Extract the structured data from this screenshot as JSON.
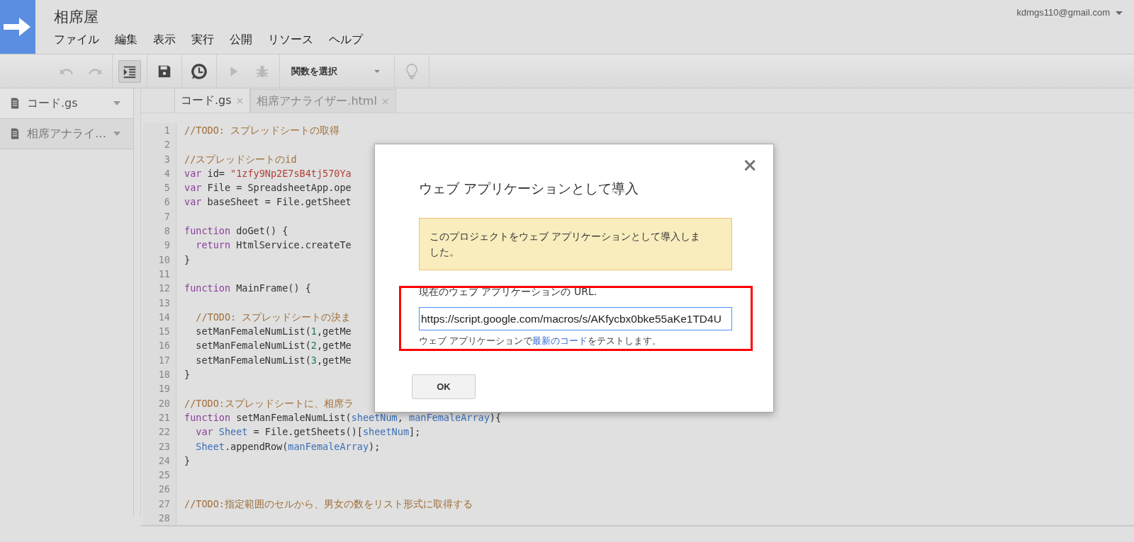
{
  "header": {
    "title": "相席屋",
    "account": "kdmgs110@gmail.com"
  },
  "menu": [
    "ファイル",
    "編集",
    "表示",
    "実行",
    "公開",
    "リソース",
    "ヘルプ"
  ],
  "toolbar": {
    "indent_pressed": true,
    "function_select": "関数を選択"
  },
  "sidebar": {
    "files": [
      {
        "name": "コード.gs",
        "selected": true
      },
      {
        "name": "相席アナライ…",
        "selected": false
      }
    ]
  },
  "tabs": [
    {
      "label": "コード.gs",
      "selected": true,
      "close": "×"
    },
    {
      "label": "相席アナライザー.html",
      "selected": false,
      "close": "×"
    }
  ],
  "code": {
    "lines": [
      {
        "number": "1",
        "tokens": [
          {
            "kind": "comment",
            "text": "//TODO: スプレッドシートの取得"
          }
        ]
      },
      {
        "number": "2"
      },
      {
        "number": "3",
        "tokens": [
          {
            "kind": "comment",
            "text": "//スプレッドシートのid"
          }
        ]
      },
      {
        "number": "4",
        "tokens": [
          {
            "kind": "keyword",
            "text": "var"
          },
          {
            "kind": "plain",
            "text": " id= "
          },
          {
            "kind": "string",
            "text": "\"1zfy9Np2E7sB4tj570Ya"
          }
        ]
      },
      {
        "number": "5",
        "tokens": [
          {
            "kind": "keyword",
            "text": "var"
          },
          {
            "kind": "plain",
            "text": " File = SpreadsheetApp.ope"
          }
        ]
      },
      {
        "number": "6",
        "tokens": [
          {
            "kind": "keyword",
            "text": "var"
          },
          {
            "kind": "plain",
            "text": " baseSheet = File.getSheet"
          }
        ]
      },
      {
        "number": "7"
      },
      {
        "number": "8",
        "tokens": [
          {
            "kind": "keyword",
            "text": "function"
          },
          {
            "kind": "plain",
            "text": " doGet() {"
          }
        ]
      },
      {
        "number": "9",
        "indented": true,
        "tokens": [
          {
            "kind": "keyword",
            "text": "return"
          },
          {
            "kind": "plain",
            "text": " HtmlService.createTe"
          }
        ]
      },
      {
        "number": "10",
        "tokens": [
          {
            "kind": "plain",
            "text": "}"
          }
        ]
      },
      {
        "number": "11"
      },
      {
        "number": "12",
        "tokens": [
          {
            "kind": "keyword",
            "text": "function"
          },
          {
            "kind": "plain",
            "text": " MainFrame() {"
          }
        ]
      },
      {
        "number": "13"
      },
      {
        "number": "14",
        "indented": true,
        "tokens": [
          {
            "kind": "comment",
            "text": "//TODO: スプレッドシートの決ま"
          }
        ]
      },
      {
        "number": "15",
        "indented": true,
        "tokens": [
          {
            "kind": "plain",
            "text": "setManFemaleNumList("
          },
          {
            "kind": "number",
            "text": "1"
          },
          {
            "kind": "plain",
            "text": ",getMe"
          }
        ]
      },
      {
        "number": "16",
        "indented": true,
        "tokens": [
          {
            "kind": "plain",
            "text": "setManFemaleNumList("
          },
          {
            "kind": "number",
            "text": "2"
          },
          {
            "kind": "plain",
            "text": ",getMe"
          }
        ]
      },
      {
        "number": "17",
        "indented": true,
        "tokens": [
          {
            "kind": "plain",
            "text": "setManFemaleNumList("
          },
          {
            "kind": "number",
            "text": "3"
          },
          {
            "kind": "plain",
            "text": ",getMe"
          }
        ]
      },
      {
        "number": "18",
        "tokens": [
          {
            "kind": "plain",
            "text": "}"
          }
        ]
      },
      {
        "number": "19"
      },
      {
        "number": "20",
        "tokens": [
          {
            "kind": "comment",
            "text": "//TODO:スプレッドシートに、相席ラ"
          }
        ]
      },
      {
        "number": "21",
        "tokens": [
          {
            "kind": "keyword",
            "text": "function"
          },
          {
            "kind": "plain",
            "text": " setManFemaleNumList("
          },
          {
            "kind": "variable",
            "text": "sheetNum"
          },
          {
            "kind": "plain",
            "text": ", "
          },
          {
            "kind": "variable",
            "text": "manFemaleArray"
          },
          {
            "kind": "plain",
            "text": "){"
          }
        ]
      },
      {
        "number": "22",
        "indented": true,
        "tokens": [
          {
            "kind": "keyword",
            "text": "var"
          },
          {
            "kind": "variable",
            "text": " Sheet"
          },
          {
            "kind": "plain",
            "text": " = File.getSheets()["
          },
          {
            "kind": "variable",
            "text": "sheetNum"
          },
          {
            "kind": "plain",
            "text": "];"
          }
        ]
      },
      {
        "number": "23",
        "indented": true,
        "tokens": [
          {
            "kind": "variable",
            "text": "Sheet"
          },
          {
            "kind": "plain",
            "text": ".appendRow("
          },
          {
            "kind": "variable",
            "text": "manFemaleArray"
          },
          {
            "kind": "plain",
            "text": ");"
          }
        ]
      },
      {
        "number": "24",
        "tokens": [
          {
            "kind": "plain",
            "text": "}"
          }
        ]
      },
      {
        "number": "25"
      },
      {
        "number": "26"
      },
      {
        "number": "27",
        "tokens": [
          {
            "kind": "comment",
            "text": "//TODO:指定範囲のセルから、男女の数をリスト形式に取得する"
          }
        ]
      },
      {
        "number": "28"
      }
    ]
  },
  "dialog": {
    "close": "×",
    "title": "ウェブ アプリケーションとして導入",
    "notice": "このプロジェクトをウェブ アプリケーションとして導入しました。",
    "url_label": "現在のウェブ アプリケーションの URL.",
    "url_value": "https://script.google.com/macros/s/AKfycbx0bke55aKe1TD4U",
    "hint_before": "ウェブ アプリケーションで",
    "hint_link": "最新のコード",
    "hint_after": "をテストします。",
    "ok": "OK"
  }
}
